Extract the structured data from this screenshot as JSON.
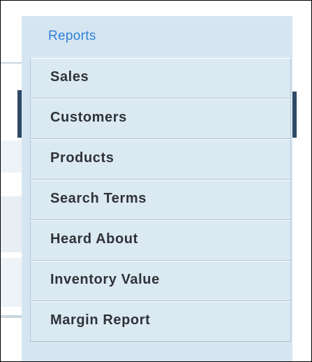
{
  "menu": {
    "header": "Reports",
    "items": [
      {
        "label": "Sales"
      },
      {
        "label": "Customers"
      },
      {
        "label": "Products"
      },
      {
        "label": "Search Terms"
      },
      {
        "label": "Heard About"
      },
      {
        "label": "Inventory Value"
      },
      {
        "label": "Margin Report"
      }
    ]
  },
  "colors": {
    "header_text": "#2e7fd6",
    "item_text": "#2f3338",
    "panel_bg": "#d6e6f1",
    "item_bg": "#dbe9f3",
    "item_border": "#b7cbd9",
    "background_dark": "#2e4a66"
  }
}
